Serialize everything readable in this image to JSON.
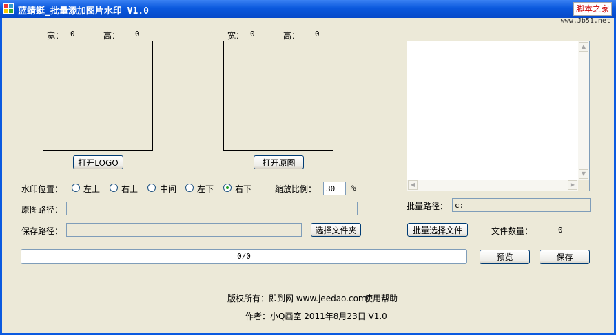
{
  "title": {
    "text": "蓝蜻蜓_批量添加图片水印 V1.0",
    "watermark": "脚本之家",
    "watermark_site": "www.Jb51.net"
  },
  "preview_logo": {
    "width_label": "宽：",
    "width_value": "0",
    "height_label": "高：",
    "height_value": "0",
    "open_button": "打开LOGO"
  },
  "preview_original": {
    "width_label": "宽：",
    "width_value": "0",
    "height_label": "高：",
    "height_value": "0",
    "open_button": "打开原图"
  },
  "watermark_position": {
    "label": "水印位置：",
    "options": [
      "左上",
      "右上",
      "中间",
      "左下",
      "右下"
    ],
    "selected": "右下"
  },
  "scale": {
    "label": "缩放比例：",
    "value": "30",
    "unit": "%"
  },
  "original_path": {
    "label": "原图路径：",
    "value": ""
  },
  "save_path": {
    "label": "保存路径：",
    "value": "",
    "button": "选择文件夹"
  },
  "batch": {
    "path_label": "批量路径：",
    "path_value": "c:",
    "select_button": "批量选择文件",
    "count_label": "文件数量：",
    "count_value": "0",
    "file_list": []
  },
  "progress": {
    "text": "0/0",
    "fraction": 0
  },
  "actions": {
    "preview": "预览",
    "save": "保存"
  },
  "footer": {
    "copyright": "版权所有：即到网 www.jeedao.com",
    "help": "使用帮助",
    "author": "作者：小Q画室 2011年8月23日 V1.0"
  },
  "colors": {
    "titlebar": "#0A58DD",
    "window_bg": "#ECE9D8",
    "radio_selected": "#21A121"
  }
}
